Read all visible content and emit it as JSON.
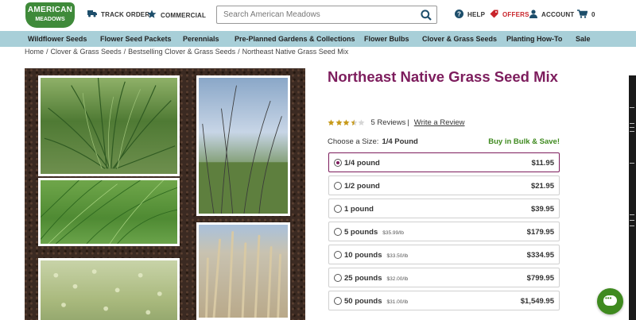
{
  "header": {
    "logo_line1": "AMERICAN",
    "logo_line2": "MEADOWS",
    "track_order": "TRACK ORDER",
    "commercial": "COMMERCIAL",
    "search_placeholder": "Search American Meadows",
    "help": "HELP",
    "offers": "OFFERS",
    "account": "ACCOUNT",
    "cart_count": "0"
  },
  "nav": {
    "items": [
      "Wildflower Seeds",
      "Flower Seed Packets",
      "Perennials",
      "Pre-Planned Gardens & Collections",
      "Flower Bulbs",
      "Clover & Grass Seeds",
      "Planting How-To",
      "Sale"
    ]
  },
  "breadcrumb": [
    "Home",
    "Clover & Grass Seeds",
    "Bestselling Clover & Grass Seeds",
    "Northeast Native Grass Seed Mix"
  ],
  "product": {
    "title": "Northeast Native Grass Seed Mix",
    "rating_value": 3.5,
    "reviews": "5 Reviews",
    "write_review": "Write a Review",
    "choose_label": "Choose a Size:",
    "choose_value": "1/4 Pound",
    "bulk": "Buy in Bulk & Save!",
    "options": [
      {
        "label": "1/4 pound",
        "unit": "",
        "price": "$11.95"
      },
      {
        "label": "1/2 pound",
        "unit": "",
        "price": "$21.95"
      },
      {
        "label": "1 pound",
        "unit": "",
        "price": "$39.95"
      },
      {
        "label": "5 pounds",
        "unit": "$35.99/lb",
        "price": "$179.95"
      },
      {
        "label": "10 pounds",
        "unit": "$33.50/lb",
        "price": "$334.95"
      },
      {
        "label": "25 pounds",
        "unit": "$32.00/lb",
        "price": "$799.95"
      },
      {
        "label": "50 pounds",
        "unit": "$31.00/lb",
        "price": "$1,549.95"
      }
    ],
    "selected_index": 0
  },
  "colors": {
    "brand_green": "#3f8a3a",
    "title_plum": "#7d1d5d",
    "nav_bg": "#a8cfd8",
    "bulk_green": "#3f8a1f",
    "offers_red": "#c8242b"
  },
  "icons": [
    "truck-icon",
    "star-icon",
    "search-icon",
    "help-icon",
    "tag-icon",
    "user-icon",
    "cart-icon",
    "chat-icon"
  ]
}
